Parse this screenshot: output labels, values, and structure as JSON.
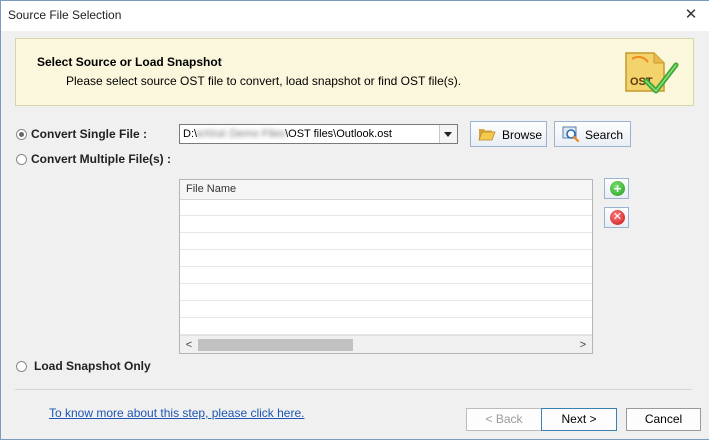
{
  "window": {
    "title": "Source File Selection",
    "close_glyph": "✕"
  },
  "banner": {
    "title": "Select Source or Load Snapshot",
    "description": "Please select source OST file to convert, load snapshot or find OST file(s).",
    "logo_text": "OST"
  },
  "options": {
    "single": {
      "label": "Convert Single File :",
      "selected": true
    },
    "multiple": {
      "label": "Convert Multiple File(s) :",
      "selected": false
    },
    "snapshot": {
      "label": "Load Snapshot Only",
      "selected": false
    }
  },
  "source_path": {
    "prefix": "D:\\",
    "blurred": "eXtra\\ Demo Files",
    "suffix": "\\OST files\\Outlook.ost"
  },
  "buttons": {
    "browse": "Browse",
    "search": "Search",
    "back": "< Back",
    "next": "Next >",
    "cancel": "Cancel"
  },
  "file_list": {
    "column_header": "File Name",
    "rows": [],
    "scroll_left": "<",
    "scroll_right": ">"
  },
  "side_actions": {
    "add_glyph": "+",
    "remove_glyph": "✕"
  },
  "help_link": "To know more about this step, please click here.",
  "icons": {
    "browse": "folder-open-icon",
    "search": "search-icon",
    "add": "add-icon",
    "remove": "remove-icon",
    "logo": "ost-check-logo"
  },
  "colors": {
    "banner_bg": "#fbf7dc",
    "link": "#1d56b4",
    "add": "#1f9b18",
    "remove": "#c61616"
  }
}
